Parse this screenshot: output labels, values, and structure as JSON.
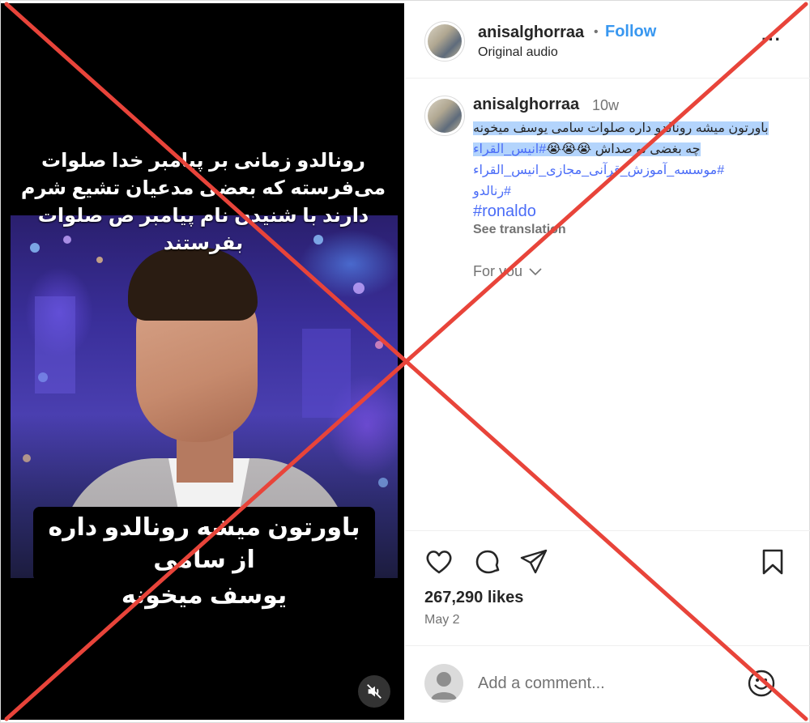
{
  "video": {
    "overlay_text": "رونالدو زمانی بر پیامبر خدا صلوات می‌فرسته که بعضی مدعیان تشیع شرم دارند با شنیدن نام پیامبر ص صلوات بفرستند",
    "caption_line1": "باورتون میشه رونالدو داره از سامی",
    "caption_line2": "یوسف میخونه",
    "mute_icon": "muted-speaker-icon"
  },
  "header": {
    "username": "anisalghorraa",
    "separator": "•",
    "follow_label": "Follow",
    "audio_label": "Original audio",
    "more_label": "···"
  },
  "caption": {
    "username": "anisalghorraa",
    "time": "10w",
    "line1": "باورتون میشه رونالدو داره صلوات سامی یوسف میخونه",
    "line2_text": "چه بغضی تو صداش",
    "line2_emojis": "😭😭😭",
    "line2_tag": "#انیس_القراء",
    "line3_tag": "#موسسه_آموزش_قرآنی_مجازی_انیس_القراء",
    "line4_tag": "#رنالدو",
    "ronaldo_tag": "#ronaldo",
    "see_translation": "See translation",
    "for_you": "For you"
  },
  "actions": {
    "like_icon": "heart-icon",
    "comment_icon": "comment-icon",
    "share_icon": "share-icon",
    "save_icon": "bookmark-icon"
  },
  "stats": {
    "likes": "267,290 likes",
    "date": "May 2"
  },
  "comment": {
    "placeholder": "Add a comment..."
  },
  "colors": {
    "follow": "#3897f0",
    "hashtag": "#4a6cf7",
    "highlight": "#b3d4fc",
    "cross": "#e8443a"
  }
}
